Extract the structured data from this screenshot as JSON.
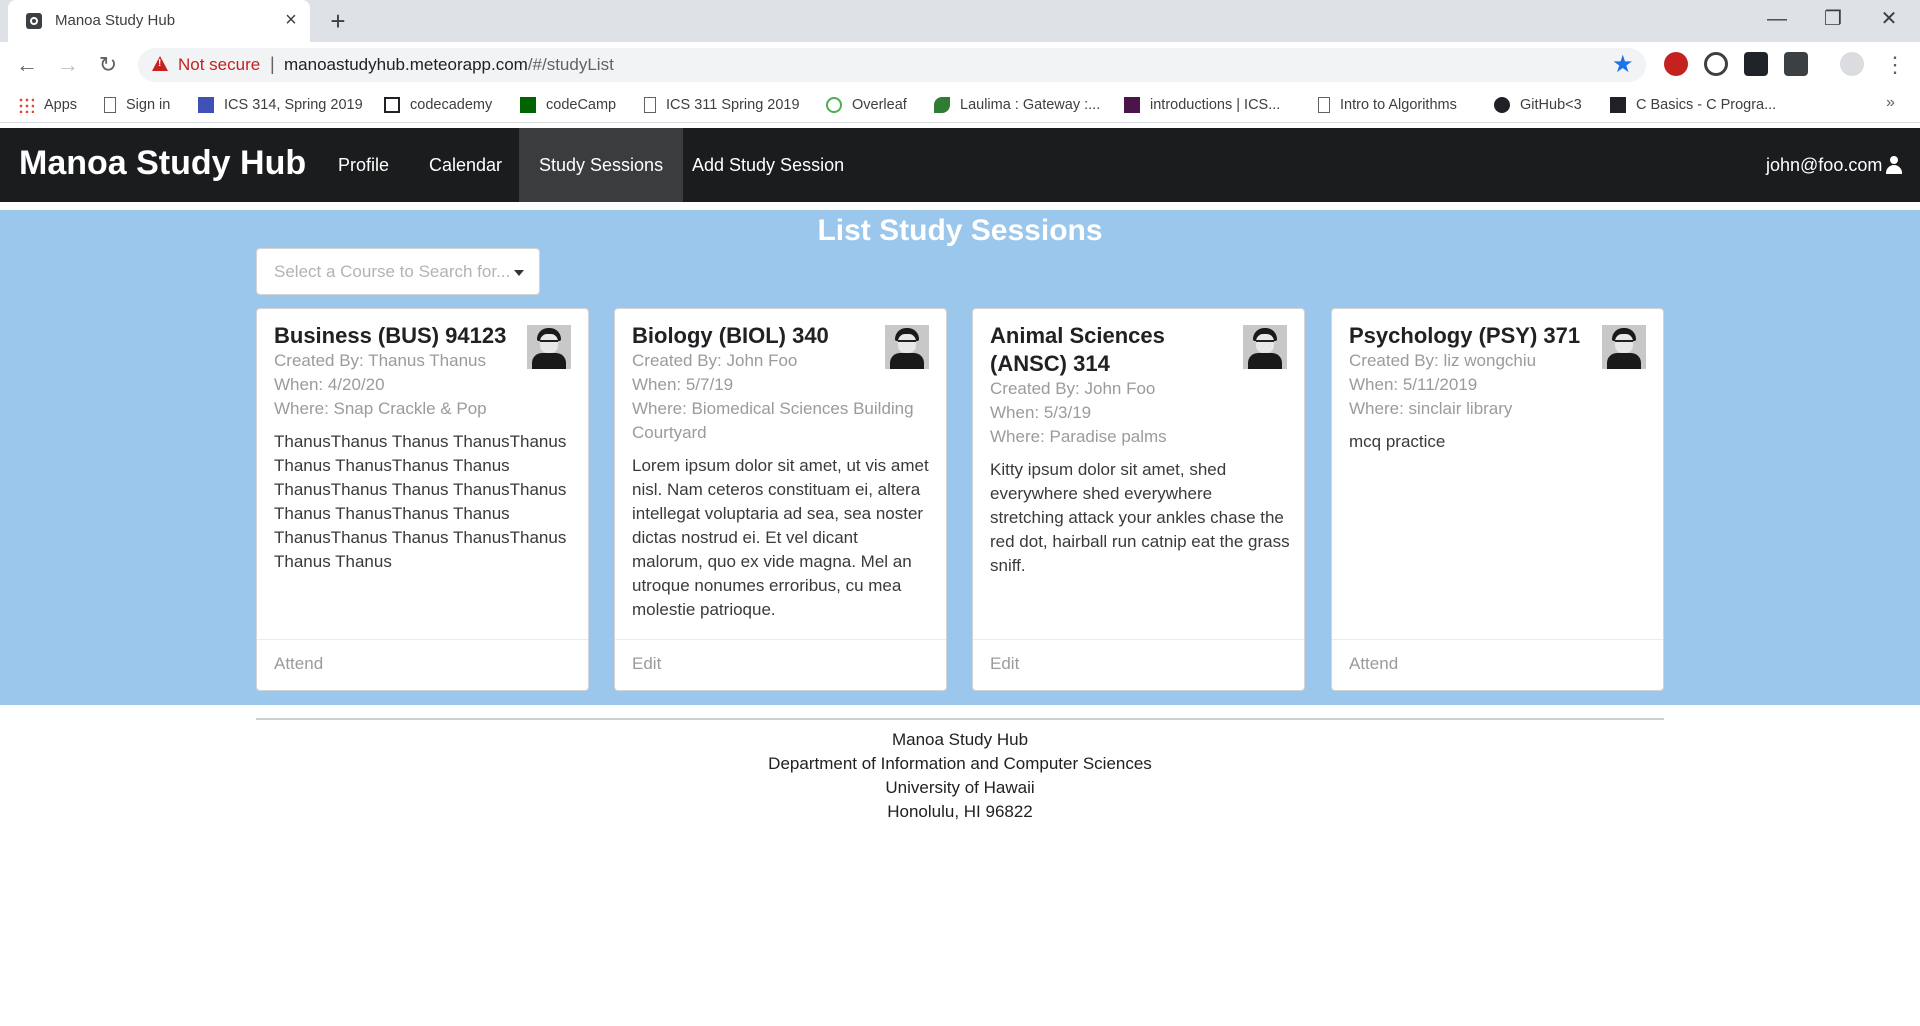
{
  "browser": {
    "tab_title": "Manoa Study Hub",
    "security_label": "Not secure",
    "url_host": "manoastudyhub.meteorapp.com",
    "url_path": "/#/studyList",
    "bookmarks": [
      "Apps",
      "Sign in",
      "ICS 314, Spring 2019",
      "codecademy",
      "codeCamp",
      "ICS 311 Spring 2019",
      "Overleaf",
      "Laulima : Gateway :...",
      "introductions | ICS...",
      "Intro to Algorithms",
      "GitHub<3",
      "C Basics - C Progra..."
    ],
    "more_bookmarks": "»"
  },
  "nav": {
    "brand": "Manoa Study Hub",
    "items": [
      "Profile",
      "Calendar",
      "Study Sessions",
      "Add Study Session"
    ],
    "active": "Study Sessions",
    "user": "john@foo.com"
  },
  "page": {
    "title": "List Study Sessions",
    "select_placeholder": "Select a Course to Search for..."
  },
  "sessions": [
    {
      "course": "Business (BUS) 94123",
      "created_by": "Created By: Thanus Thanus",
      "when": "When: 4/20/20",
      "where": "Where: Snap Crackle & Pop",
      "description": "ThanusThanus Thanus ThanusThanus Thanus ThanusThanus Thanus ThanusThanus Thanus ThanusThanus Thanus ThanusThanus Thanus ThanusThanus Thanus ThanusThanus Thanus Thanus",
      "action": "Attend"
    },
    {
      "course": "Biology (BIOL) 340",
      "created_by": "Created By: John Foo",
      "when": "When: 5/7/19",
      "where": "Where: Biomedical Sciences Building Courtyard",
      "description": "Lorem ipsum dolor sit amet, ut vis amet nisl. Nam ceteros constituam ei, altera intellegat voluptaria ad sea, sea noster dictas nostrud ei. Et vel dicant malorum, quo ex vide magna. Mel an utroque nonumes erroribus, cu mea molestie patrioque.",
      "action": "Edit"
    },
    {
      "course": "Animal Sciences (ANSC) 314",
      "created_by": "Created By: John Foo",
      "when": "When: 5/3/19",
      "where": "Where: Paradise palms",
      "description": "Kitty ipsum dolor sit amet, shed everywhere shed everywhere stretching attack your ankles chase the red dot, hairball run catnip eat the grass sniff.",
      "action": "Edit"
    },
    {
      "course": "Psychology (PSY) 371",
      "created_by": "Created By: liz wongchiu",
      "when": "When: 5/11/2019",
      "where": "Where: sinclair library",
      "description": "mcq practice",
      "action": "Attend"
    }
  ],
  "footer": {
    "line1": "Manoa Study Hub",
    "line2": "Department of Information and Computer Sciences",
    "line3": "University of Hawaii",
    "line4": "Honolulu, HI 96822"
  },
  "colors": {
    "navbar": "#1b1c1d",
    "main_background": "#9bc7ec",
    "security_warning": "#c5221f",
    "bookmark_star": "#1a73e8"
  }
}
